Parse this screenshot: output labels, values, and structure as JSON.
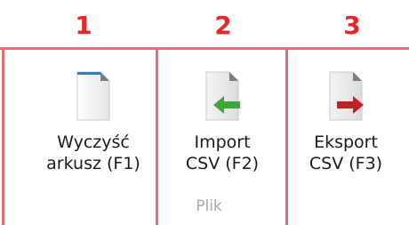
{
  "annotations": {
    "numbers": [
      "1",
      "2",
      "3"
    ],
    "color": "#e8262a",
    "frame_color": "#e56e6e"
  },
  "ribbon": {
    "group_label": "Plik",
    "buttons": [
      {
        "line1": "Wyczyść",
        "line2": "arkusz (F1)",
        "icon": "blank-page-icon"
      },
      {
        "line1": "Import",
        "line2": "CSV (F2)",
        "icon": "import-csv-icon"
      },
      {
        "line1": "Eksport",
        "line2": "CSV (F3)",
        "icon": "export-csv-icon"
      }
    ]
  }
}
